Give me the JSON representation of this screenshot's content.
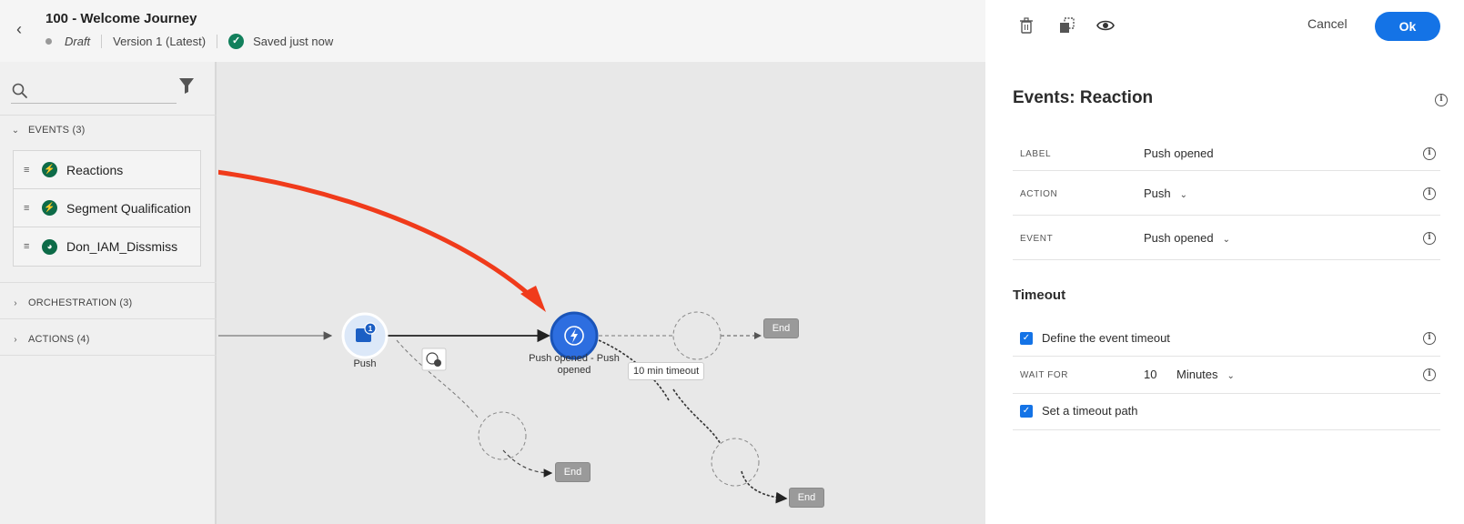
{
  "header": {
    "journey_title": "100 - Welcome Journey",
    "status": "Draft",
    "version": "Version 1 (Latest)",
    "saved": "Saved just now"
  },
  "palette": {
    "search": {
      "placeholder": ""
    },
    "sections": [
      {
        "label": "EVENTS (3)",
        "expanded": true
      },
      {
        "label": "ORCHESTRATION (3)",
        "expanded": false
      },
      {
        "label": "ACTIONS (4)",
        "expanded": false
      }
    ],
    "events": [
      {
        "label": "Reactions",
        "icon": "lightning-icon"
      },
      {
        "label": "Segment Qualification",
        "icon": "lightning-icon"
      },
      {
        "label": "Don_IAM_Dissmiss",
        "icon": "globe-icon"
      }
    ]
  },
  "canvas": {
    "push_label": "Push",
    "push_badge": "1",
    "event_label": "Push opened - Push opened",
    "timeout_label": "10 min timeout",
    "end_label": "End"
  },
  "panel": {
    "cancel_label": "Cancel",
    "ok_label": "Ok",
    "title": "Events: Reaction",
    "fields": {
      "label": {
        "name": "LABEL",
        "value": "Push opened"
      },
      "action": {
        "name": "ACTION",
        "value": "Push"
      },
      "event": {
        "name": "EVENT",
        "value": "Push opened"
      }
    },
    "timeout_section": "Timeout",
    "define_timeout_label": "Define the event timeout",
    "wait_for": {
      "name": "WAIT FOR",
      "value": "10",
      "unit": "Minutes"
    },
    "timeout_path_label": "Set a timeout path"
  },
  "colors": {
    "accent": "#1473e6",
    "annotation_arrow": "#f03b1b",
    "event_icon": "#0d6b48",
    "saved_check": "#12805c"
  }
}
